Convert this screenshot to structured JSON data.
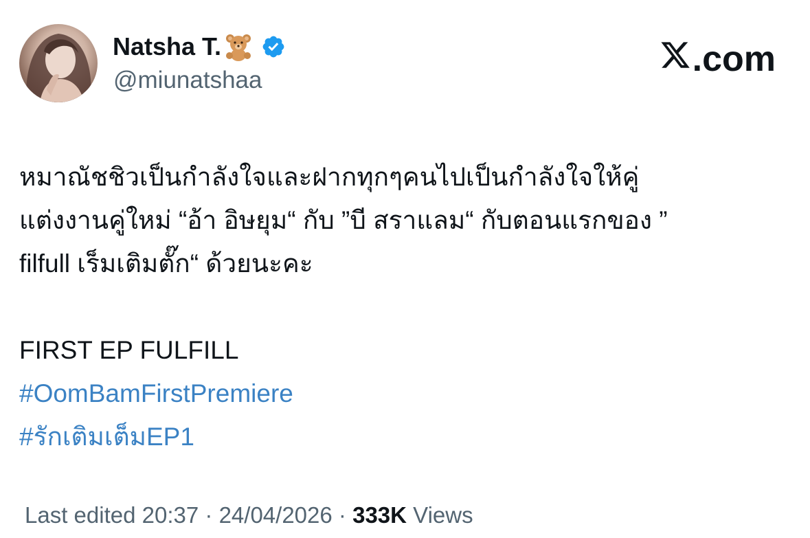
{
  "author": {
    "display_name": "Natsha T.",
    "handle": "@miunatshaa",
    "name_emoji": "teddy-bear-emoji",
    "verified_icon": "verified-badge-icon",
    "verified_color": "#1d9bf0"
  },
  "brand": {
    "logo_icon": "x-logo-icon",
    "suffix": ".com"
  },
  "tweet": {
    "lines": [
      "หมาณัชชิวเป็นกำลังใจและฝากทุกๆคนไปเป็นกำลังใจให้คู่",
      "แต่งงานคู่ใหม่ “อ้า อิษยุม“ กับ ”บี สราแลม“ กับตอนแรกของ ”",
      "filfull เร็มเติมตั๊ก“ ด้วยนะคะ"
    ],
    "plain_line": "FIRST EP FULFILL",
    "hashtags": [
      "#OomBamFirstPremiere",
      "#รักเติมเต็มEP1"
    ],
    "hashtag_color": "#3b82c4"
  },
  "meta": {
    "edited_label": "Last edited",
    "time": "20:37",
    "separator": "·",
    "date": "24/04/2026",
    "views_count": "333K",
    "views_label": "Views"
  }
}
